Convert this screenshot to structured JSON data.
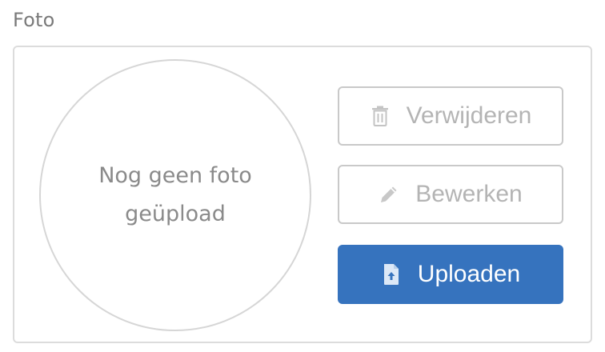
{
  "photo_field": {
    "label": "Foto",
    "placeholder_text": "Nog geen foto geüpload"
  },
  "actions": {
    "delete": {
      "label": "Verwijderen",
      "icon": "trash-icon",
      "disabled": true
    },
    "edit": {
      "label": "Bewerken",
      "icon": "pencil-icon",
      "disabled": true
    },
    "upload": {
      "label": "Uploaden",
      "icon": "file-upload-icon",
      "disabled": false
    }
  },
  "colors": {
    "primary": "#3673be",
    "disabled_text": "#b4b4b4",
    "border": "#dcdcdc"
  }
}
